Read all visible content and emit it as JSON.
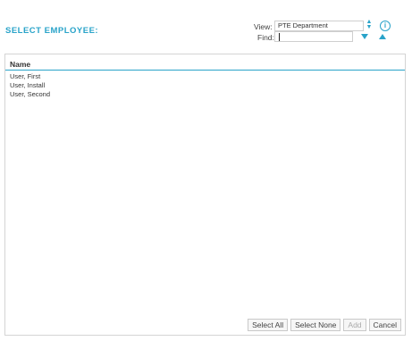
{
  "title": "SELECT EMPLOYEE:",
  "filters": {
    "view_label": "View:",
    "view_value": "PTE Department",
    "find_label": "Find:",
    "find_value": ""
  },
  "icons": {
    "select_arrows": "sort-arrows-icon",
    "info": "info-icon",
    "find_next": "caret-down-icon",
    "find_prev": "caret-up-icon"
  },
  "list": {
    "header": "Name",
    "items": [
      "User, First",
      "User, Install",
      "User, Second"
    ]
  },
  "buttons": {
    "select_all": "Select All",
    "select_none": "Select None",
    "add": "Add",
    "cancel": "Cancel"
  },
  "colors": {
    "accent": "#29a3c9"
  }
}
